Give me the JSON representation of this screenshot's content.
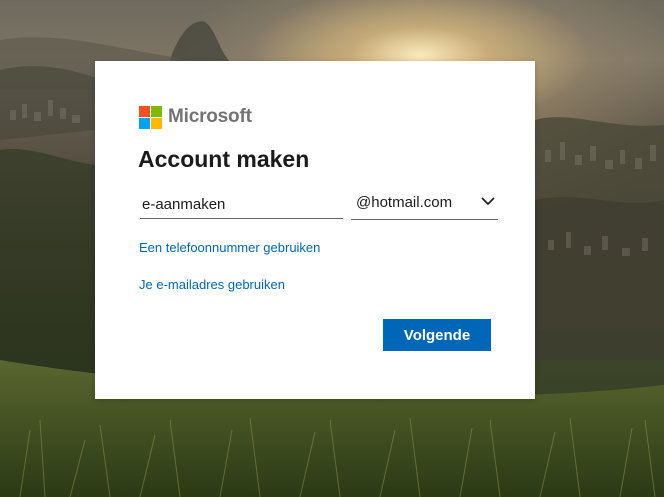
{
  "brand": {
    "name": "Microsoft",
    "logo_colors": [
      "#f25022",
      "#7fba00",
      "#00a4ef",
      "#ffb900"
    ]
  },
  "form": {
    "title": "Account maken",
    "email_value": "e-aanmaken",
    "domain_selected": "@hotmail.com",
    "phone_link": "Een telefoonnummer gebruiken",
    "email_link": "Je e-mailadres gebruiken",
    "next_button": "Volgende"
  },
  "colors": {
    "accent": "#0067b8",
    "card_background": "#ffffff",
    "text": "#1b1b1b"
  },
  "icons": {
    "dropdown": "chevron-down-icon",
    "logo": "microsoft-logo-icon"
  }
}
